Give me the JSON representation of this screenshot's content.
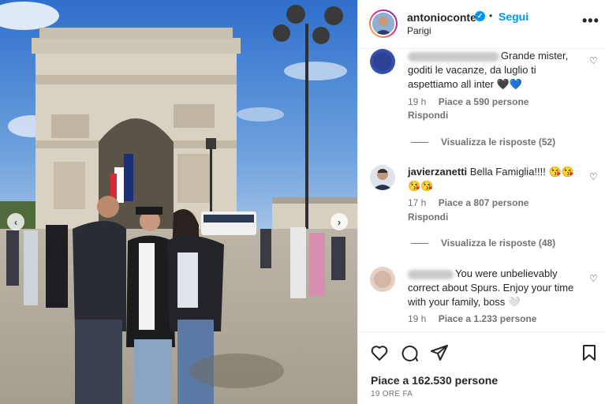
{
  "post": {
    "username": "antonioconte",
    "dot": "•",
    "follow_label": "Segui",
    "location": "Parigi",
    "more_label": "•••"
  },
  "comments": [
    {
      "text": "Grande mister, goditi le vacanze, da luglio ti aspettiamo all inter 🖤💙",
      "time": "19 h",
      "likes": "Piace a 590 persone",
      "reply_label": "Rispondi",
      "view_replies": "Visualizza le risposte (52)"
    },
    {
      "username": "javierzanetti",
      "text": "Bella Famiglia!!!! 😘😘😘😘",
      "time": "17 h",
      "likes": "Piace a 807 persone",
      "reply_label": "Rispondi",
      "view_replies": "Visualizza le risposte (48)"
    },
    {
      "text": "You were unbelievably correct about Spurs. Enjoy your time with your family, boss 🤍",
      "time": "19 h",
      "likes": "Piace a 1.233 persone"
    }
  ],
  "footer": {
    "likes_total": "Piace a 162.530 persone",
    "time_ago": "19 ORE FA"
  },
  "icons": {
    "heart": "heart-icon",
    "comment": "comment-icon",
    "share": "paper-plane-icon",
    "save": "bookmark-icon"
  },
  "colors": {
    "link_blue": "#0095f6",
    "text": "#262626",
    "muted": "#737373",
    "sky": "#3f7fcf"
  }
}
